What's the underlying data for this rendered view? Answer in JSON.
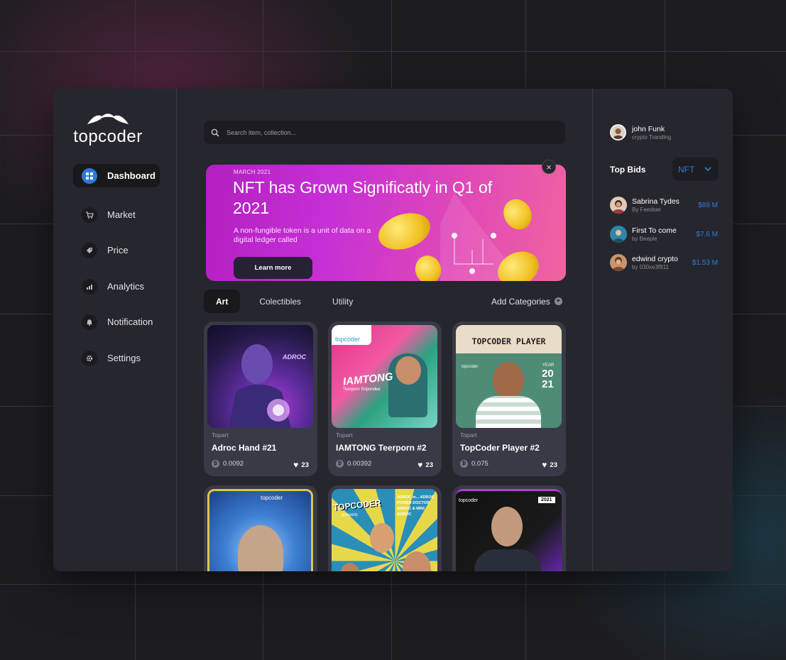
{
  "brand": {
    "name": "topcoder"
  },
  "sidebar": {
    "items": [
      {
        "label": "Dashboard",
        "icon": "grid-icon",
        "active": true
      },
      {
        "label": "Market",
        "icon": "cart-icon",
        "active": false
      },
      {
        "label": "Price",
        "icon": "tag-icon",
        "active": false
      },
      {
        "label": "Analytics",
        "icon": "chart-icon",
        "active": false
      },
      {
        "label": "Notification",
        "icon": "bell-icon",
        "active": false
      },
      {
        "label": "Settings",
        "icon": "gear-icon",
        "active": false
      }
    ]
  },
  "search": {
    "placeholder": "Search item, collection..."
  },
  "banner": {
    "kicker": "MARCH 2021",
    "title": "NFT has Grown Significatly in Q1 of 2021",
    "description": "A non-fungible token is a unit of data on a digital ledger called",
    "cta": "Learn more",
    "close": "×"
  },
  "tabs": [
    {
      "label": "Art",
      "active": true
    },
    {
      "label": "Colectibles",
      "active": false
    },
    {
      "label": "Utility",
      "active": false
    }
  ],
  "add_categories": {
    "label": "Add Categories",
    "icon": "+"
  },
  "cards": [
    {
      "creator": "Topart",
      "name": "Adroc Hand #21",
      "price": "0.0092",
      "likes": "23",
      "art_text": "ADROC"
    },
    {
      "creator": "Topart",
      "name": "IAMTONG Teerporn #2",
      "price": "0.00392",
      "likes": "23",
      "art_text": "IAMTONG",
      "art_sub": "Teerporn Sripondee",
      "art_brand": "topcoder"
    },
    {
      "creator": "Topart",
      "name": "TopCoder Player #2",
      "price": "0.075",
      "likes": "23",
      "art_text": "TOPCODER PLAYER",
      "art_year_label": "YEAR",
      "art_year_1": "20",
      "art_year_2": "21",
      "art_brand": "topcoder"
    }
  ],
  "cards_row2": [
    {
      "art_brand": "topcoder"
    },
    {
      "art_title": "TOPCODER",
      "art_presents": "presents",
      "art_caption": "ADROC in... ADROC POWER DOCTOR ADROC & MINI ADROC"
    },
    {
      "art_brand": "topcoder",
      "art_year": "2021"
    }
  ],
  "user": {
    "name": "john Funk",
    "subtitle": "crypto Tranding"
  },
  "top_bids": {
    "title": "Top Bids",
    "filter": "NFT",
    "items": [
      {
        "name": "Sabrina Tydes",
        "by": "By Feedset",
        "amount": "$89 M"
      },
      {
        "name": "First To come",
        "by": "by Beeple",
        "amount": "$7.6 M"
      },
      {
        "name": "edwind crypto",
        "by": "by 030xe3f911",
        "amount": "$1.53 M"
      }
    ]
  },
  "colors": {
    "accent": "#2d7bd6",
    "panel": "#26262e",
    "banner_from": "#b21fc2",
    "banner_to": "#f064a0"
  }
}
